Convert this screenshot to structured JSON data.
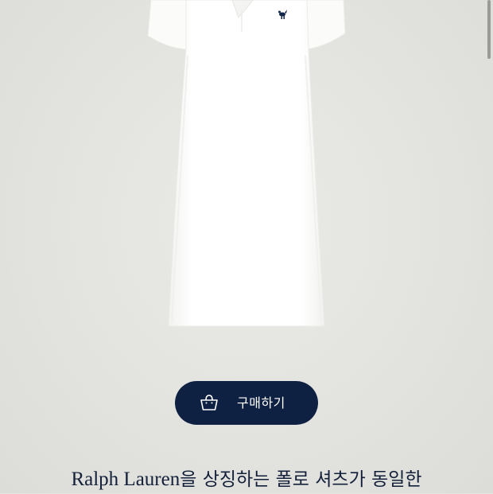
{
  "product": {
    "image_alt": "white polo dress",
    "logo_icon": "pony-logo-icon"
  },
  "buy_button": {
    "label": "구매하기",
    "icon": "shopping-basket-icon"
  },
  "description": {
    "brand": "Ralph Lauren",
    "text": "을 상징하는 폴로 셔츠가 동일한"
  },
  "colors": {
    "background": "#e4e4e0",
    "button": "#0f2142",
    "button_text": "#ffffff",
    "text": "#14203a"
  }
}
